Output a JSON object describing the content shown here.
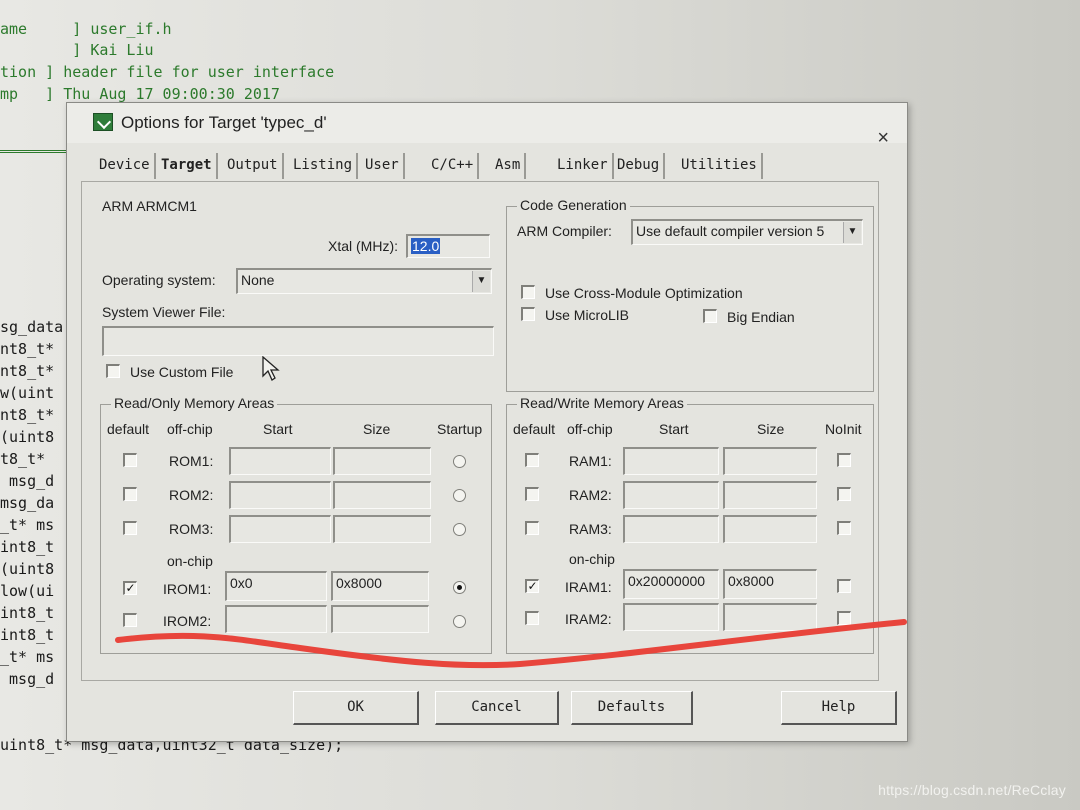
{
  "editor": {
    "header_lines": [
      {
        "left": "ame",
        "bracket": "]",
        "value": "user_if.h"
      },
      {
        "left": "",
        "bracket": "]",
        "value": "Kai Liu"
      },
      {
        "left": "tion",
        "bracket": "]",
        "value": "header file for user interface"
      },
      {
        "left": "mp",
        "bracket": "]",
        "value": "Thu Aug 17 09:00:30 2017"
      }
    ],
    "code_lines": [
      "sg_data",
      "nt8_t*",
      "nt8_t*",
      "w(uint",
      "nt8_t*",
      "(uint8",
      "t8_t*",
      " msg_d",
      "msg_da",
      "_t* ms",
      "int8_t",
      "(uint8",
      "low(ui",
      "int8_t",
      "int8_t",
      "_t* ms",
      " msg_d"
    ],
    "bottom_line": "uint8_t* msg_data,uint32_t data_size);"
  },
  "dialog": {
    "title": "Options for Target 'typec_d'",
    "close_symbol": "×",
    "tabs": [
      "Device",
      "Target",
      "Output",
      "Listing",
      "User",
      "C/C++",
      "Asm",
      "Linker",
      "Debug",
      "Utilities"
    ],
    "active_tab": "Target",
    "device": "ARM ARMCM1",
    "xtal_label": "Xtal (MHz):",
    "xtal_value": "12.0",
    "os_label": "Operating system:",
    "os_value": "None",
    "svf_label": "System Viewer File:",
    "svf_value": "",
    "use_custom_file": "Use Custom File",
    "code_generation": {
      "title": "Code Generation",
      "compiler_label": "ARM Compiler:",
      "compiler_value": "Use default compiler version 5",
      "cross_module": "Use Cross-Module Optimization",
      "microlib": "Use MicroLIB",
      "big_endian": "Big Endian"
    },
    "ro_memory": {
      "title": "Read/Only Memory Areas",
      "headers": [
        "default",
        "off-chip",
        "Start",
        "Size",
        "Startup"
      ],
      "on_chip_label": "on-chip",
      "rows": [
        {
          "label": "ROM1:",
          "start": "",
          "size": "",
          "default": false,
          "startup": false
        },
        {
          "label": "ROM2:",
          "start": "",
          "size": "",
          "default": false,
          "startup": false
        },
        {
          "label": "ROM3:",
          "start": "",
          "size": "",
          "default": false,
          "startup": false
        },
        {
          "label": "IROM1:",
          "start": "0x0",
          "size": "0x8000",
          "default": true,
          "startup": true
        },
        {
          "label": "IROM2:",
          "start": "",
          "size": "",
          "default": false,
          "startup": false
        }
      ]
    },
    "rw_memory": {
      "title": "Read/Write Memory Areas",
      "headers": [
        "default",
        "off-chip",
        "Start",
        "Size",
        "NoInit"
      ],
      "on_chip_label": "on-chip",
      "rows": [
        {
          "label": "RAM1:",
          "start": "",
          "size": "",
          "default": false
        },
        {
          "label": "RAM2:",
          "start": "",
          "size": "",
          "default": false
        },
        {
          "label": "RAM3:",
          "start": "",
          "size": "",
          "default": false
        },
        {
          "label": "IRAM1:",
          "start": "0x20000000",
          "size": "0x8000",
          "default": true
        },
        {
          "label": "IRAM2:",
          "start": "",
          "size": "",
          "default": false
        }
      ]
    },
    "buttons": {
      "ok": "OK",
      "cancel": "Cancel",
      "defaults": "Defaults",
      "help": "Help"
    }
  },
  "annotation_color": "#e8453c",
  "watermark": "https://blog.csdn.net/ReCclay"
}
